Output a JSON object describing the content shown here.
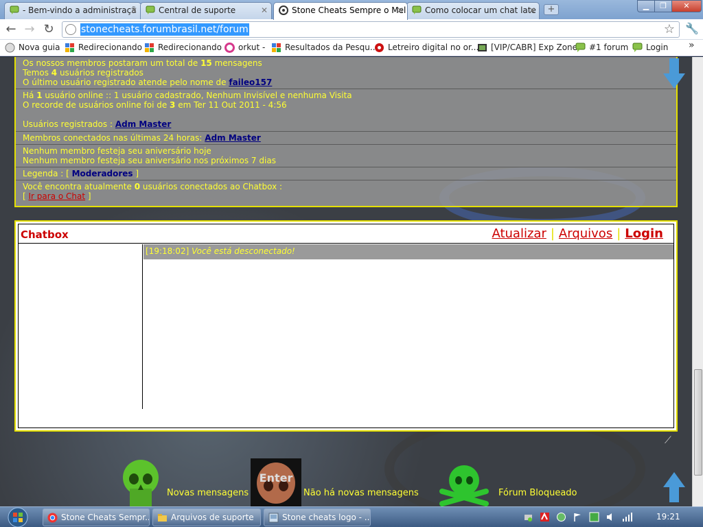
{
  "tabs": [
    {
      "title": "- Bem-vindo a administraçã",
      "active": false,
      "icon": "chat-bubble-icon"
    },
    {
      "title": "Central de suporte",
      "active": false,
      "icon": "chat-bubble-icon"
    },
    {
      "title": "Stone Cheats Sempre o Mel",
      "active": true,
      "icon": "swirl-icon"
    },
    {
      "title": "Como colocar um chat late",
      "active": false,
      "icon": "chat-bubble-icon"
    }
  ],
  "toolbar": {
    "url": "stonecheats.forumbrasil.net/forum"
  },
  "bookmarks": [
    {
      "label": "Nova guia",
      "icon": "globe-icon"
    },
    {
      "label": "Redirecionando",
      "icon": "google-icon"
    },
    {
      "label": "Redirecionando",
      "icon": "google-icon"
    },
    {
      "label": "orkut -",
      "icon": "orkut-icon"
    },
    {
      "label": "Resultados da Pesqu...",
      "icon": "google-icon"
    },
    {
      "label": "Letreiro digital no or...",
      "icon": "record-icon"
    },
    {
      "label": "[VIP/CABR] Exp Zone",
      "icon": "image-icon"
    },
    {
      "label": "#1 forum",
      "icon": "chat-bubble-icon"
    },
    {
      "label": "Login",
      "icon": "chat-bubble-icon"
    }
  ],
  "stats": {
    "posts_prefix": "Os nossos membros postaram um total de ",
    "posts_count": "15",
    "posts_suffix": " mensagens",
    "users_prefix": "Temos ",
    "users_count": "4",
    "users_suffix": " usuários registrados",
    "last_user_prefix": "O último usuário registrado atende pelo nome de ",
    "last_user": "faileo157",
    "online_prefix": "Há ",
    "online_count": "1",
    "online_suffix": " usuário online :: 1 usuário cadastrado, Nenhum Invisível e nenhuma Visita",
    "record_prefix": "O recorde de usuários online foi de ",
    "record_count": "3",
    "record_suffix": " em Ter 11 Out 2011 - 4:56",
    "registered_label": "Usuários registrados : ",
    "registered_user": "Adm Master",
    "connected_label": "Membros conectados nas últimas 24 horas: ",
    "connected_user": "Adm Master",
    "birthday_today": "Nenhum membro festeja seu aniversário hoje",
    "birthday_week": "Nenhum membro festeja seu aniversário nos próximos 7 dias",
    "legend_label": "Legenda : ",
    "legend_item": "Moderadores",
    "chat_prefix": "Você encontra atualmente ",
    "chat_count": "0",
    "chat_suffix": " usuários conectados ao Chatbox :",
    "chat_link": "Ir para o Chat"
  },
  "chatbox": {
    "title": "Chatbox",
    "refresh": "Atualizar",
    "archives": "Arquivos",
    "login": "Login",
    "message_time": "[19:18:02]",
    "message_text": "Você está desconectado!"
  },
  "legend": [
    {
      "label": "Novas mensagens",
      "icon": "green-skull-icon"
    },
    {
      "label": "Não há novas mensagens",
      "icon": "enter-skull-icon"
    },
    {
      "label": "Fórum Bloqueado",
      "icon": "skull-crossbones-icon"
    }
  ],
  "taskbar": {
    "tasks": [
      {
        "label": "Stone Cheats Sempr...",
        "icon": "chrome-icon"
      },
      {
        "label": "Arquivos de suporte",
        "icon": "folder-icon"
      },
      {
        "label": "Stone cheats logo - ...",
        "icon": "paint-icon"
      }
    ],
    "clock": "19:21"
  }
}
